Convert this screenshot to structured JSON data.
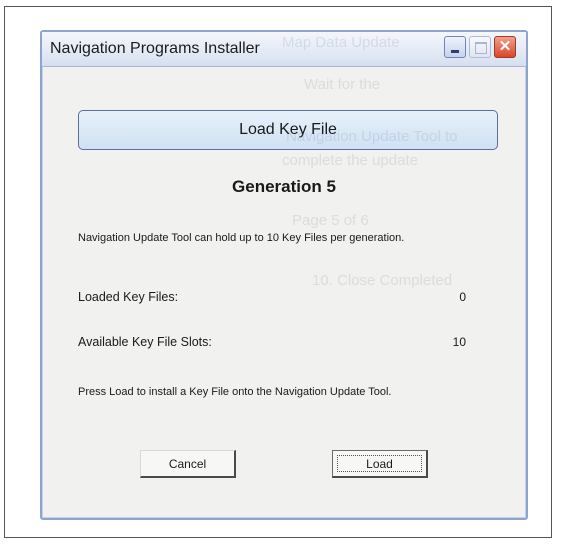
{
  "window": {
    "title": "Navigation Programs Installer",
    "controls": {
      "minimize_icon": "minimize-icon",
      "maximize_icon": "maximize-icon",
      "close_icon": "close-icon",
      "close_glyph": "✕"
    }
  },
  "background_ghost_text": [
    "Map Data Update",
    "Wait for the",
    "Navigation Update Tool to",
    "complete the update",
    "Page 5 of 6",
    "10. Close Completed"
  ],
  "main": {
    "header_label": "Load Key File",
    "generation_label": "Generation 5",
    "info_text": "Navigation Update Tool can hold up to 10 Key Files per generation.",
    "stats": [
      {
        "label": "Loaded Key Files:",
        "value": "0"
      },
      {
        "label": "Available Key File Slots:",
        "value": "10"
      }
    ],
    "instruction_text": "Press Load to install a Key File onto the Navigation Update Tool."
  },
  "buttons": {
    "cancel_label": "Cancel",
    "load_label": "Load"
  },
  "colors": {
    "title_bar": "#dfe6f3",
    "close_button": "#d9462a",
    "banner": "#dce9f7"
  }
}
